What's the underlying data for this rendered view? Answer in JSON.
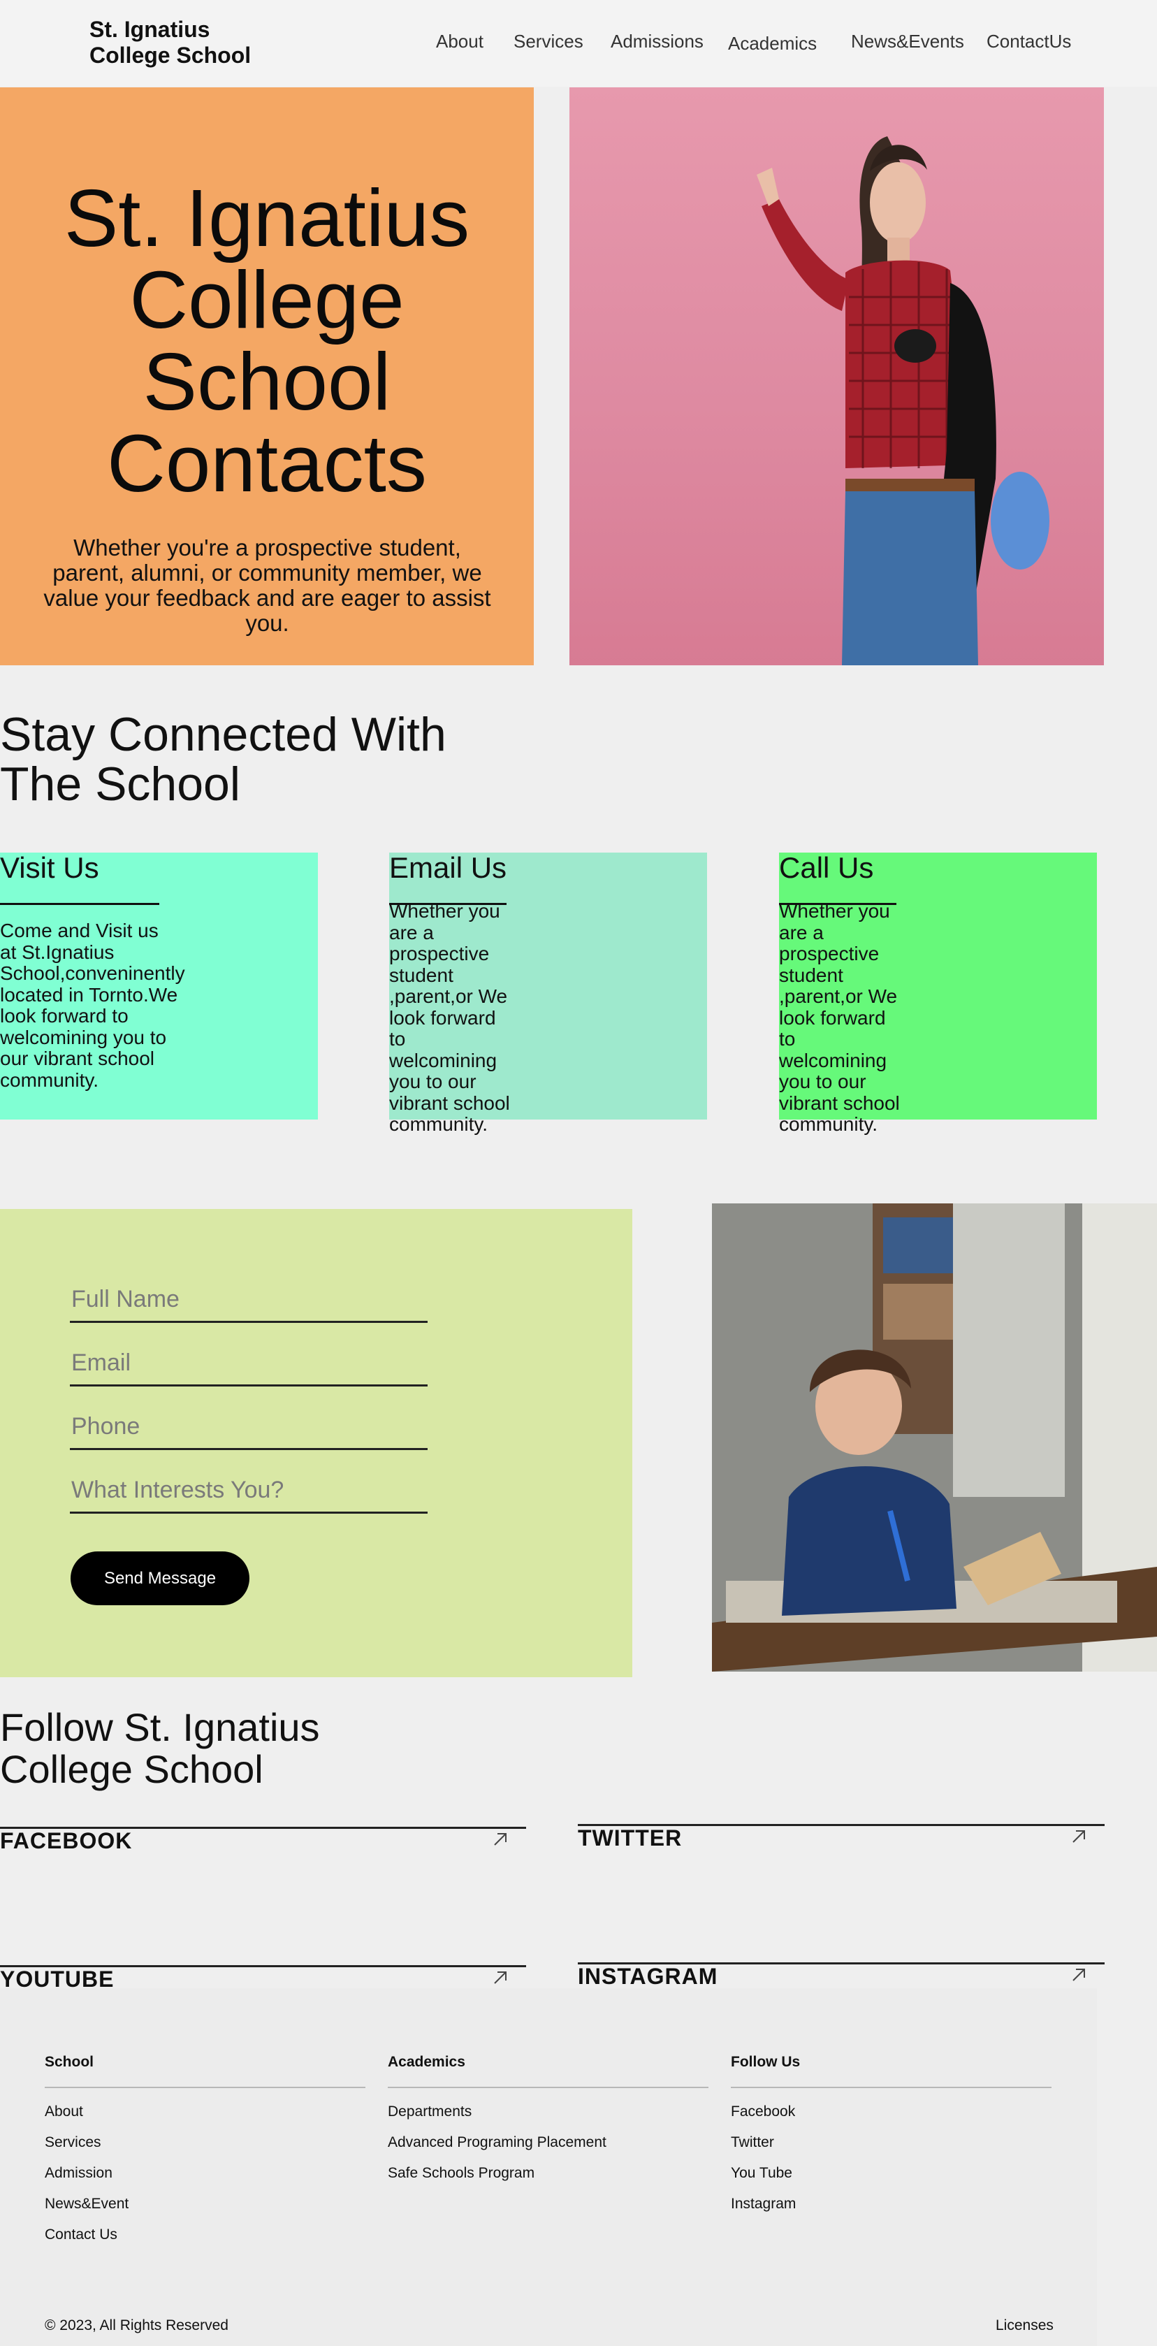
{
  "header": {
    "logo_line1": "St. Ignatius",
    "logo_line2": "College School",
    "nav": [
      {
        "label": "About"
      },
      {
        "label": "Services"
      },
      {
        "label": "Admissions"
      },
      {
        "label": "Academics"
      },
      {
        "label": "News&Events"
      },
      {
        "label": "ContactUs"
      }
    ]
  },
  "hero": {
    "title_line1": "St. Ignatius",
    "title_line2": "College School",
    "title_line3": "Contacts",
    "subtitle": "Whether you're a prospective student, parent, alumni, or community member, we value your feedback and are eager to assist you.",
    "colors": {
      "panel": "#f4a764",
      "photo_bg": "#e08ea4"
    }
  },
  "connected": {
    "title_line1": "Stay Connected With",
    "title_line2": "The School",
    "cards": [
      {
        "title": "Visit Us",
        "text": "Come and Visit us at St.Ignatius School,conveninently located in Tornto.We look forward to welcomining you to our vibrant school community.",
        "color": "#80ffd3"
      },
      {
        "title": "Email Us",
        "text": "Whether you are a prospective student ,parent,or We look forward to welcomining you to our vibrant school community.",
        "color": "#9ee9cd"
      },
      {
        "title": "Call Us",
        "text": "Whether you are a prospective student ,parent,or We look forward to welcomining you to our vibrant school community.",
        "color": "#66f97a"
      }
    ]
  },
  "form": {
    "fields": [
      {
        "placeholder": "Full Name"
      },
      {
        "placeholder": "Email"
      },
      {
        "placeholder": "Phone"
      },
      {
        "placeholder": "What Interests You?"
      }
    ],
    "submit_label": "Send Message",
    "panel_color": "#d9e8a5"
  },
  "follow": {
    "title_line1": "Follow St. Ignatius",
    "title_line2": "College School",
    "links": [
      {
        "label": "FACEBOOK"
      },
      {
        "label": "TWITTER"
      },
      {
        "label": "YOUTUBE"
      },
      {
        "label": "INSTAGRAM"
      }
    ],
    "arrow_icon": "arrow-up-right-icon"
  },
  "footer": {
    "columns": [
      {
        "title": "School",
        "links": [
          "About",
          "Services",
          "Admission",
          "News&Event",
          "Contact Us"
        ]
      },
      {
        "title": "Academics",
        "links": [
          "Departments",
          "Advanced Programing Placement",
          "Safe Schools Program"
        ]
      },
      {
        "title": "Follow Us",
        "links": [
          "Facebook",
          "Twitter",
          "You Tube",
          "Instagram"
        ]
      }
    ],
    "copyright": "© 2023, All Rights Reserved",
    "licenses": "Licenses"
  }
}
